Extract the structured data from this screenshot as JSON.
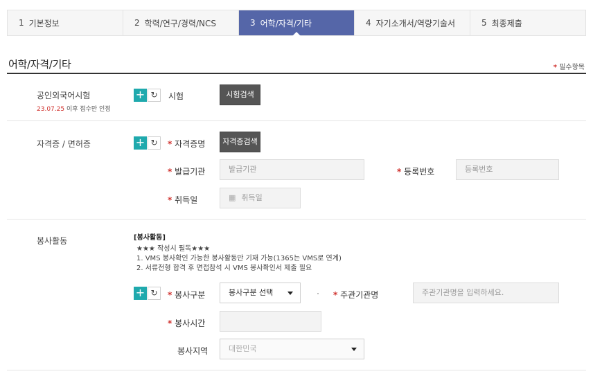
{
  "steps": [
    {
      "num": "1",
      "label": "기본정보",
      "active": false
    },
    {
      "num": "2",
      "label": "학력/연구/경력/NCS",
      "active": false
    },
    {
      "num": "3",
      "label": "어학/자격/기타",
      "active": true
    },
    {
      "num": "4",
      "label": "자기소개서/역량기술서",
      "active": false
    },
    {
      "num": "5",
      "label": "최종제출",
      "active": false
    }
  ],
  "section": {
    "title": "어학/자격/기타",
    "required_note": "필수항목"
  },
  "language": {
    "label": "공인외국어시험",
    "sub_date": "23.07.25",
    "sub_text": " 이후 접수만 인정",
    "field_label": "시험",
    "search_button": "시험검색"
  },
  "license": {
    "label": "자격증 / 면허증",
    "field_label": "자격증명",
    "search_button": "자격증검색",
    "issuer_label": "발급기관",
    "issuer_placeholder": "발급기관",
    "regno_label": "등록번호",
    "regno_placeholder": "등록번호",
    "date_label": "취득일",
    "date_placeholder": "취득일"
  },
  "volunteer": {
    "label": "봉사활동",
    "notes_head": "[봉사활동]",
    "notes": [
      "★★★ 작성시 필독★★★",
      "1. VMS 봉사확인 가능한 봉사활동만 기재 가능(1365는 VMS로 연계)",
      "2. 서류전형 합격 후 면접참석 시 VMS 봉사확인서 제출 필요"
    ],
    "type_label": "봉사구분",
    "type_value": "봉사구분 선택",
    "org_label": "주관기관명",
    "org_placeholder": "주관기관명을 입력하세요.",
    "hours_label": "봉사시간",
    "region_label": "봉사지역",
    "region_value": "대한민국"
  },
  "icons": {
    "add": "plus-icon",
    "refresh": "refresh-icon",
    "calendar": "calendar-icon",
    "caret": "chevron-down-icon"
  },
  "colors": {
    "active_step": "#5566a8",
    "add_button": "#1fa9ad",
    "required": "#d0312d",
    "dark_button": "#555555"
  }
}
